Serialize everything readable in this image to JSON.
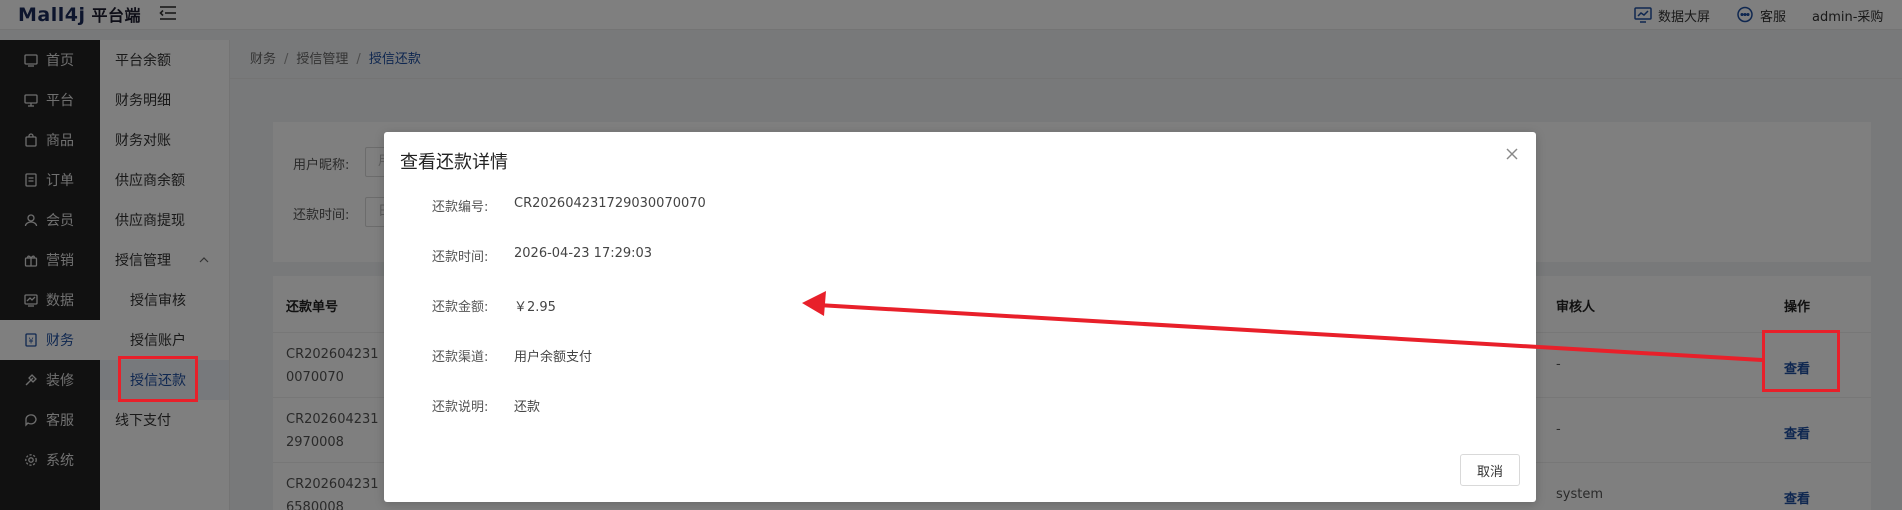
{
  "header": {
    "logo_brand": "Mall4j",
    "logo_sub": "平台端",
    "data_screen_label": "数据大屏",
    "service_label": "客服",
    "user_label": "admin-采购"
  },
  "sidebar": {
    "items": [
      {
        "label": "首页",
        "icon": "home-icon"
      },
      {
        "label": "平台",
        "icon": "platform-icon"
      },
      {
        "label": "商品",
        "icon": "product-icon"
      },
      {
        "label": "订单",
        "icon": "order-icon"
      },
      {
        "label": "会员",
        "icon": "member-icon"
      },
      {
        "label": "营销",
        "icon": "marketing-icon"
      },
      {
        "label": "数据",
        "icon": "data-icon"
      },
      {
        "label": "财务",
        "icon": "finance-icon"
      },
      {
        "label": "装修",
        "icon": "decoration-icon"
      },
      {
        "label": "客服",
        "icon": "service-icon"
      },
      {
        "label": "系统",
        "icon": "settings-icon"
      }
    ],
    "active_index": 7
  },
  "submenu": {
    "items": [
      "平台余额",
      "财务明细",
      "财务对账",
      "供应商余额",
      "供应商提现",
      "授信管理",
      "授信审核",
      "授信账户",
      "授信还款",
      "线下支付"
    ]
  },
  "breadcrumb": {
    "level1": "财务",
    "level2": "授信管理",
    "level3": "授信还款"
  },
  "search": {
    "nickname_label": "用户昵称:",
    "nickname_placeholder": "用",
    "time_label": "还款时间:",
    "time_placeholder": "日"
  },
  "table": {
    "headers": {
      "repay_no": "还款单号",
      "reviewer": "审核人",
      "action": "操作"
    },
    "rows": [
      {
        "repay_no_line1": "CR202604231",
        "repay_no_line2": "0070070",
        "reviewer": "-",
        "action": "查看"
      },
      {
        "repay_no_line1": "CR202604231",
        "repay_no_line2": "2970008",
        "reviewer": "-",
        "action": "查看"
      },
      {
        "repay_no_line1": "CR202604231",
        "repay_no_line2": "6580008",
        "reviewer": "system",
        "action": "查看"
      }
    ]
  },
  "modal": {
    "title": "查看还款详情",
    "fields": [
      {
        "label": "还款编号:",
        "value": "CR202604231729030070070"
      },
      {
        "label": "还款时间:",
        "value": "2026-04-23 17:29:03"
      },
      {
        "label": "还款金额:",
        "value": "￥2.95"
      },
      {
        "label": "还款渠道:",
        "value": "用户余额支付"
      },
      {
        "label": "还款说明:",
        "value": "还款"
      }
    ],
    "cancel_label": "取消"
  },
  "colors": {
    "accent": "#1f4fa0",
    "annotation": "#e8202a",
    "sidebar_bg": "#222222"
  }
}
